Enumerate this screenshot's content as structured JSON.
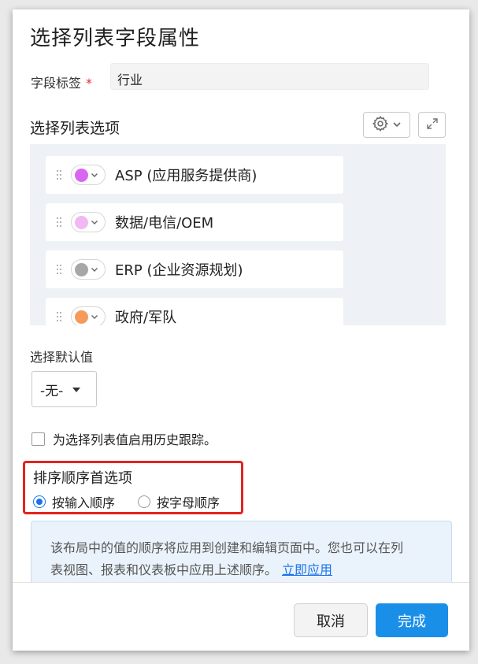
{
  "dialog": {
    "title": "选择列表字段属性"
  },
  "field": {
    "label": "字段标签",
    "required_mark": "*",
    "value": "行业"
  },
  "options_section": {
    "label": "选择列表选项",
    "settings_icon": "gear-icon",
    "expand_icon": "expand-icon",
    "items": [
      {
        "text": "ASP (应用服务提供商)",
        "color": "#d966f0"
      },
      {
        "text": "数据/电信/OEM",
        "color": "#f3b8f4"
      },
      {
        "text": "ERP (企业资源规划)",
        "color": "#a7a7a7"
      },
      {
        "text": "政府/军队",
        "color": "#f59a5b"
      }
    ]
  },
  "default_value": {
    "label": "选择默认值",
    "selected": "-无-"
  },
  "history_tracking": {
    "label": "为选择列表值启用历史跟踪。",
    "checked": false
  },
  "sort_preference": {
    "title": "排序顺序首选项",
    "options": [
      {
        "label": "按输入顺序",
        "checked": true
      },
      {
        "label": "按字母顺序",
        "checked": false
      }
    ]
  },
  "info": {
    "line1": "该布局中的值的顺序将应用到创建和编辑页面中。您也可以在列",
    "line2": "表视图、报表和仪表板中应用上述顺序。",
    "link": "立即应用"
  },
  "footer": {
    "cancel_label": "取消",
    "done_label": "完成"
  },
  "colors": {
    "accent": "#1a8fe8",
    "highlight_border": "#e3241f",
    "info_bg": "#eaf3fc"
  }
}
